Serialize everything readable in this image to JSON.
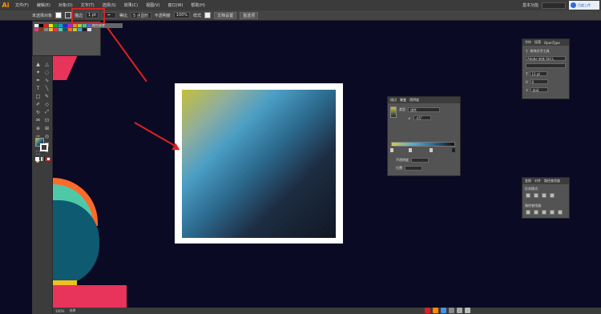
{
  "app": {
    "logo": "Ai",
    "menu": [
      "文件(F)",
      "编辑(E)",
      "对象(O)",
      "文字(T)",
      "选择(S)",
      "效果(C)",
      "视图(V)",
      "窗口(W)",
      "帮助(H)"
    ],
    "workspace": "基本功能",
    "baidu_label": "百度上传"
  },
  "control": {
    "selection_label": "未选择对象",
    "stroke_label": "描边",
    "stroke_value": "1 pt",
    "profile_label": "等比",
    "brush_value": "5 点圆形",
    "opacity_label": "不透明度",
    "opacity_value": "100%",
    "style_label": "样式",
    "doc_setup": "文档设置",
    "prefs": "首选项"
  },
  "swatch_panel": {
    "tab": "颜色参考"
  },
  "gradient_panel": {
    "tabs": [
      "描边",
      "渐变",
      "透明度"
    ],
    "type_label": "类型",
    "type_value": "线性",
    "angle_value": "-45°",
    "location_label": "不透明度",
    "position_label": "位置"
  },
  "character_panel": {
    "tabs": [
      "字符",
      "段落",
      "OpenType"
    ],
    "touch_label": "修饰文字工具",
    "font_name": "Adobe 宋体 Std L",
    "size_value": "12 pt",
    "leading_value": "自动",
    "tracking_value": "0"
  },
  "pathfinder_panel": {
    "tabs": [
      "变换",
      "对齐",
      "路径查找器"
    ],
    "shape_mode_label": "形状模式:",
    "pathfinder_label": "路径查找器:"
  },
  "status": {
    "zoom": "100%",
    "tool": "选择"
  },
  "colors": {
    "canvas": "#0a0a24",
    "highlight": "#e02020",
    "grad_start": "#c9c23a",
    "grad_mid": "#4aa0c8",
    "grad_end": "#0d1420"
  }
}
